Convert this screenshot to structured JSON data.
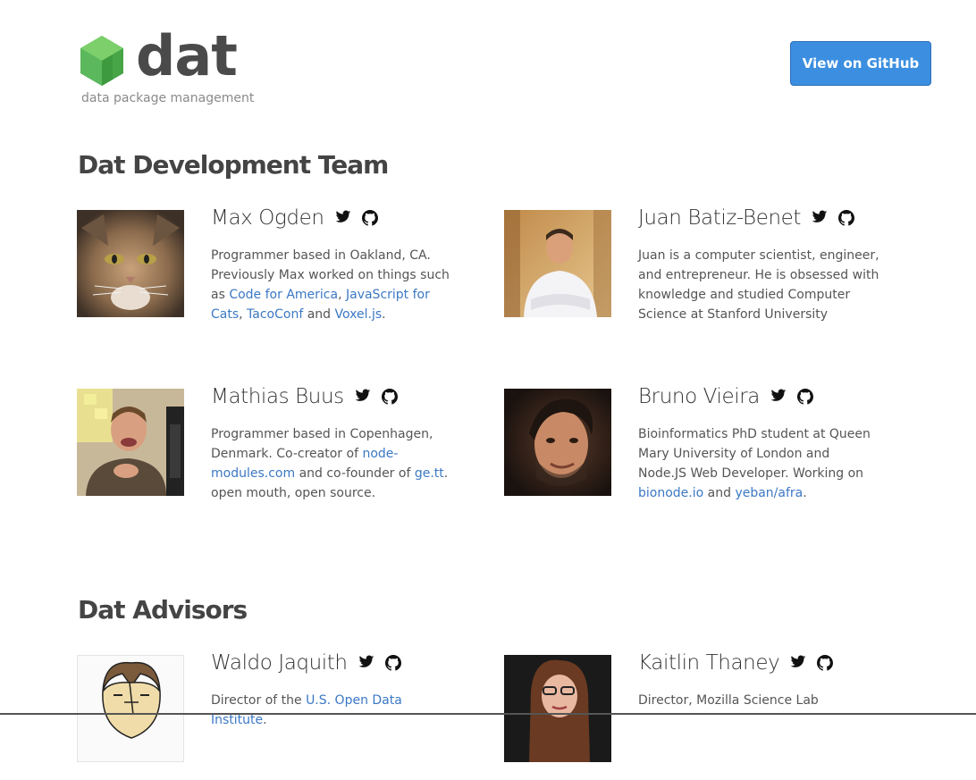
{
  "header": {
    "logo_word": "dat",
    "tagline": "data package management",
    "github_button": "View on GitHub",
    "brand_color": "#5cb85c",
    "button_color": "#3c8fe0"
  },
  "team": {
    "title": "Dat Development Team",
    "members": [
      {
        "name": "Max Ogden",
        "bio": [
          {
            "t": "Programmer based in Oakland, CA. Previously Max worked on things such as "
          },
          {
            "t": "Code for America",
            "link": true
          },
          {
            "t": ", "
          },
          {
            "t": "JavaScript for Cats",
            "link": true
          },
          {
            "t": ", "
          },
          {
            "t": "TacoConf",
            "link": true
          },
          {
            "t": " and "
          },
          {
            "t": "Voxel.js",
            "link": true
          },
          {
            "t": "."
          }
        ]
      },
      {
        "name": "Juan Batiz-Benet",
        "bio": [
          {
            "t": "Juan is a computer scientist, engineer, and entrepreneur. He is obsessed with knowledge and studied Computer Science at Stanford University"
          }
        ]
      },
      {
        "name": "Mathias Buus",
        "bio": [
          {
            "t": "Programmer based in Copenhagen, Denmark. Co-creator of "
          },
          {
            "t": "node-modules.com",
            "link": true
          },
          {
            "t": " and co-founder of "
          },
          {
            "t": "ge.tt",
            "link": true
          },
          {
            "t": ". open mouth, open source."
          }
        ]
      },
      {
        "name": "Bruno Vieira",
        "bio": [
          {
            "t": "Bioinformatics PhD student at Queen Mary University of London and Node.JS Web Developer. Working on "
          },
          {
            "t": "bionode.io",
            "link": true
          },
          {
            "t": " and "
          },
          {
            "t": "yeban/afra",
            "link": true
          },
          {
            "t": "."
          }
        ]
      }
    ]
  },
  "advisors": {
    "title": "Dat Advisors",
    "members": [
      {
        "name": "Waldo Jaquith",
        "bio": [
          {
            "t": "Director of the "
          },
          {
            "t": "U.S. Open Data Institute",
            "link": true
          },
          {
            "t": "."
          }
        ]
      },
      {
        "name": "Kaitlin Thaney",
        "bio": [
          {
            "t": "Director, Mozilla Science Lab"
          }
        ]
      }
    ]
  }
}
